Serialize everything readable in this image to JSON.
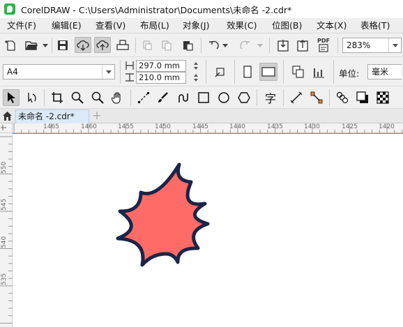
{
  "window": {
    "title": "CorelDRAW - C:\\Users\\Administrator\\Documents\\未命名 -2.cdr*"
  },
  "menu": {
    "items": [
      "文件(F)",
      "编辑(E)",
      "查看(V)",
      "布局(L)",
      "对象(J)",
      "效果(C)",
      "位图(B)",
      "文本(X)",
      "表格(T)"
    ]
  },
  "toolbar": {
    "zoom_value": "283%",
    "pdf_label": "PDF"
  },
  "property_bar": {
    "page_size": "A4",
    "width": "297.0 mm",
    "height": "210.0 mm",
    "units_label": "单位:",
    "units_value": "毫米"
  },
  "toolbox": {
    "text_tool_glyph": "字"
  },
  "tabs": {
    "document": "未命名 -2.cdr*",
    "add": "+"
  },
  "rulers": {
    "horizontal": [
      "1465",
      "1460",
      "1455",
      "1450",
      "1445",
      "1440",
      "1435",
      "1430",
      "1425",
      "1420"
    ],
    "vertical": [
      "550",
      "545",
      "540",
      "535"
    ]
  },
  "shape": {
    "type": "8-point star",
    "fill": "#ff6b66",
    "outline": "#1c2447"
  }
}
